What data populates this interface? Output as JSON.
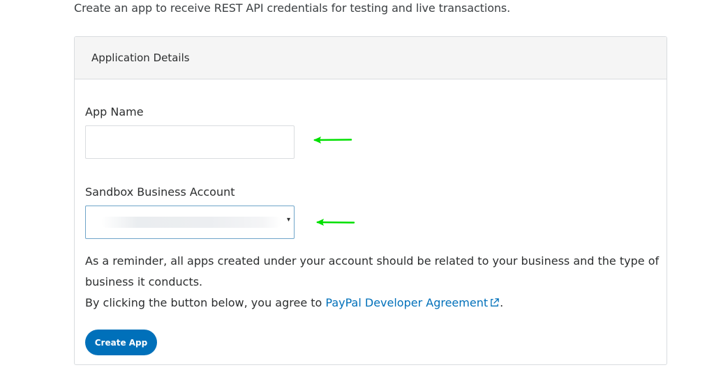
{
  "intro": {
    "text": "Create an app to receive REST API credentials for testing and live transactions."
  },
  "panel": {
    "title": "Application Details",
    "app_name": {
      "label": "App Name",
      "value": "",
      "placeholder": ""
    },
    "sandbox_account": {
      "label": "Sandbox Business Account",
      "selected_value": "",
      "caret": "▾"
    },
    "reminder": "As a reminder, all apps created under your account should be related to your business and the type of business it conducts.",
    "agreement": {
      "prefix": "By clicking the button below, you agree to ",
      "link_text": "PayPal Developer Agreement",
      "suffix": "."
    },
    "create_button_label": "Create App"
  },
  "annotations": {
    "arrow_color": "#00e000",
    "icons": [
      "left-arrow-icon",
      "external-link-icon",
      "chevron-down-icon"
    ]
  },
  "colors": {
    "link": "#0070ba",
    "button_bg": "#0070ba",
    "header_bg": "#f5f5f5",
    "border": "#d9dcdf",
    "focus_border": "#6fa5c9"
  }
}
